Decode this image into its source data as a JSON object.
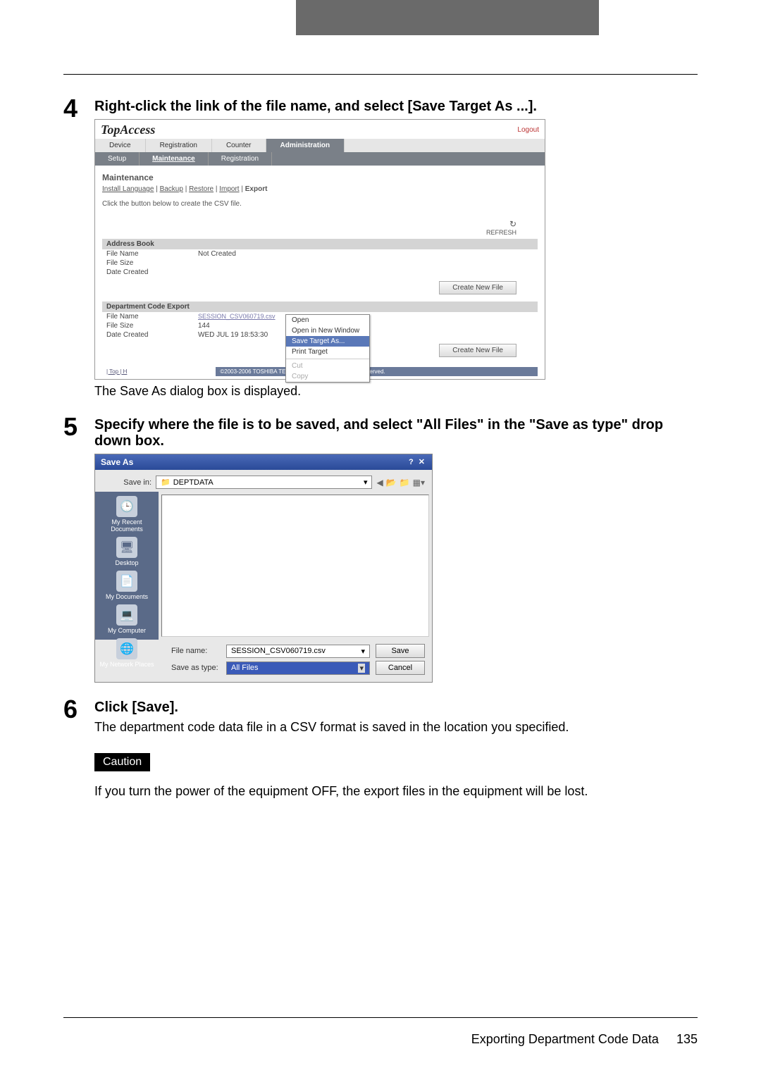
{
  "steps": {
    "s4": {
      "num": "4",
      "title": "Right-click the link of the file name, and select [Save Target As ...].",
      "after_text": "The Save As dialog box is displayed."
    },
    "s5": {
      "num": "5",
      "title": "Specify where the file is to be saved, and select \"All Files\" in the \"Save as type\" drop down box."
    },
    "s6": {
      "num": "6",
      "title": "Click [Save].",
      "text": "The department code data file in a CSV format is saved in the location you specified.",
      "caution_label": "Caution",
      "caution_text": "If you turn the power of the equipment OFF, the export files in the equipment will be lost."
    }
  },
  "topaccess": {
    "logo": "TopAccess",
    "logout": "Logout",
    "tabs": [
      "Device",
      "Registration",
      "Counter",
      "Administration"
    ],
    "active_tab": "Administration",
    "subtabs": [
      "Setup",
      "Maintenance",
      "Registration"
    ],
    "active_sub": "Maintenance",
    "section": "Maintenance",
    "links": [
      {
        "label": "Install Language",
        "u": true
      },
      {
        "label": "Backup",
        "u": true
      },
      {
        "label": "Restore",
        "u": true
      },
      {
        "label": "Import",
        "u": true
      },
      {
        "label": "Export",
        "u": false
      }
    ],
    "instruction": "Click the button below to create the CSV file.",
    "refresh": "REFRESH",
    "address_book": {
      "header": "Address Book",
      "rows": [
        {
          "label": "File Name",
          "value": "Not Created"
        },
        {
          "label": "File Size",
          "value": ""
        },
        {
          "label": "Date Created",
          "value": ""
        }
      ],
      "button": "Create New File"
    },
    "dept": {
      "header": "Department Code Export",
      "rows": [
        {
          "label": "File Name",
          "value": "SESSION_CSV060719.csv",
          "link": true
        },
        {
          "label": "File Size",
          "value": "144"
        },
        {
          "label": "Date Created",
          "value": "WED JUL 19 18:53:30"
        }
      ],
      "button": "Create New File"
    },
    "context_items": [
      "Open",
      "Open in New Window",
      "Save Target As...",
      "Print Target",
      "Cut",
      "Copy"
    ],
    "context_sel": "Save Target As...",
    "footer_left": "| Top | H",
    "footer_right": "©2003-2006 TOSHIBA TEC CORPORATION All Rights Reserved."
  },
  "saveas": {
    "title": "Save As",
    "title_buttons": "?  ✕",
    "savein_label": "Save in:",
    "savein_value": "DEPTDATA",
    "side": [
      "My Recent Documents",
      "Desktop",
      "My Documents",
      "My Computer",
      "My Network Places"
    ],
    "filename_label": "File name:",
    "filename_value": "SESSION_CSV060719.csv",
    "saveastype_label": "Save as type:",
    "saveastype_value": "All Files",
    "save_btn": "Save",
    "cancel_btn": "Cancel"
  },
  "footer": {
    "text": "Exporting Department Code Data",
    "page": "135"
  }
}
